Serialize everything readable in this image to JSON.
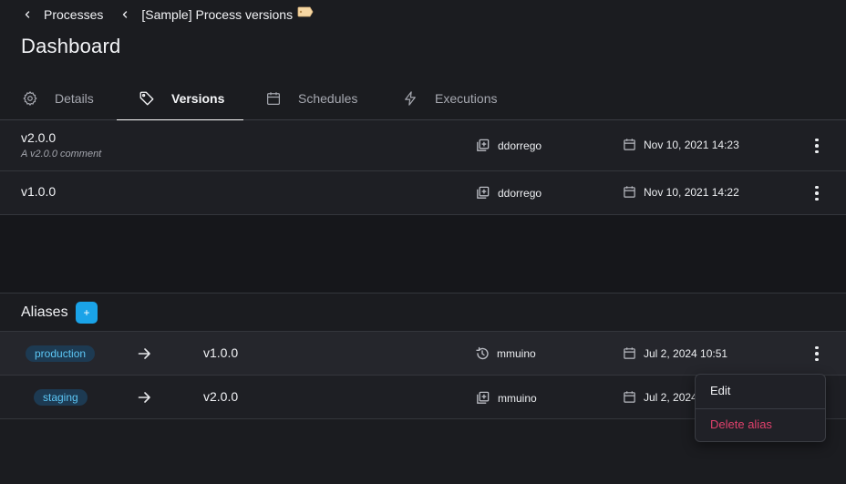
{
  "breadcrumb": {
    "items": [
      {
        "label": "Processes"
      },
      {
        "label": "[Sample] Process versions"
      }
    ]
  },
  "header": {
    "title": "Dashboard"
  },
  "tabs": [
    {
      "label": "Details",
      "icon": "gear-icon"
    },
    {
      "label": "Versions",
      "icon": "tag-icon",
      "active": true
    },
    {
      "label": "Schedules",
      "icon": "calendar-icon"
    },
    {
      "label": "Executions",
      "icon": "lightning-icon"
    }
  ],
  "versions": [
    {
      "name": "v2.0.0",
      "comment": "A v2.0.0 comment",
      "author": "ddorrego",
      "date": "Nov 10, 2021 14:23"
    },
    {
      "name": "v1.0.0",
      "comment": "",
      "author": "ddorrego",
      "date": "Nov 10, 2021 14:22"
    }
  ],
  "aliases": {
    "title": "Aliases",
    "add_label": "+",
    "rows": [
      {
        "alias": "production",
        "version": "v1.0.0",
        "author": "mmuino",
        "author_icon": "history-icon",
        "date": "Jul 2, 2024 10:51"
      },
      {
        "alias": "staging",
        "version": "v2.0.0",
        "author": "mmuino",
        "author_icon": "add-box-icon",
        "date": "Jul 2, 2024"
      }
    ]
  },
  "context_menu": {
    "edit_label": "Edit",
    "delete_label": "Delete alias"
  },
  "colors": {
    "accent": "#1aa3e8",
    "badge_bg": "#1d3a52",
    "badge_text": "#5cc6f5",
    "danger": "#e0416c",
    "background": "#1b1c20"
  }
}
